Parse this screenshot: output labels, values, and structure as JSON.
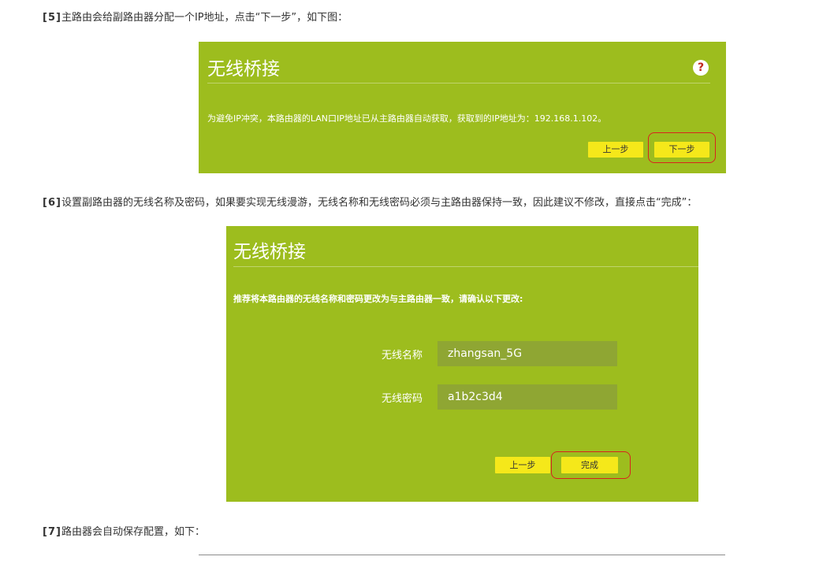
{
  "steps": [
    {
      "num": "[5]",
      "text": "主路由会给副路由器分配一个IP地址，点击“下一步”，如下图："
    },
    {
      "num": "[6]",
      "text": "设置副路由器的无线名称及密码，如果要实现无线漫游，无线名称和无线密码必须与主路由器保持一致，因此建议不修改，直接点击“完成”："
    },
    {
      "num": "[7]",
      "text": "路由器会自动保存配置，如下："
    }
  ],
  "panel1": {
    "title": "无线桥接",
    "help_glyph": "?",
    "message": "为避免IP冲突，本路由器的LAN口IP地址已从主路由器自动获取，获取到的IP地址为：192.168.1.102。",
    "prev_label": "上一步",
    "next_label": "下一步"
  },
  "panel2": {
    "title": "无线桥接",
    "message": "推荐将本路由器的无线名称和密码更改为与主路由器一致，请确认以下更改:",
    "ssid_label": "无线名称",
    "ssid_value": "zhangsan_5G",
    "pwd_label": "无线密码",
    "pwd_value": "a1b2c3d4",
    "prev_label": "上一步",
    "finish_label": "完成"
  },
  "colors": {
    "panel_bg": "#9dbd1e",
    "button": "#f5e81a",
    "highlight_ring": "#d8231d",
    "field_bg": "#8fa633"
  }
}
